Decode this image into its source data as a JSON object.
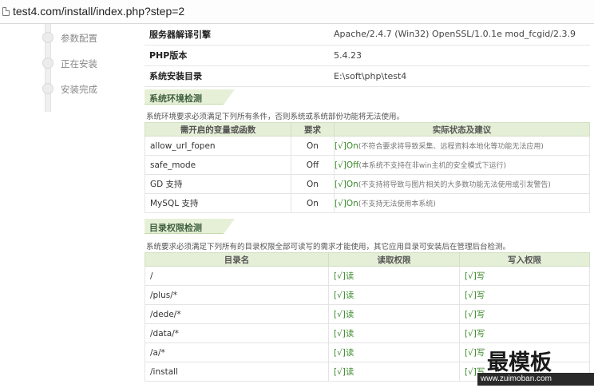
{
  "address_bar": {
    "url": "test4.com/install/index.php?step=2"
  },
  "sidebar": {
    "items": [
      {
        "label": "参数配置"
      },
      {
        "label": "正在安装"
      },
      {
        "label": "安装完成"
      }
    ]
  },
  "server_info": {
    "rows": [
      {
        "label": "服务器解译引擎",
        "value": "Apache/2.4.7 (Win32) OpenSSL/1.0.1e mod_fcgid/2.3.9"
      },
      {
        "label": "PHP版本",
        "value": "5.4.23"
      },
      {
        "label": "系统安装目录",
        "value": "E:\\soft\\php\\test4"
      }
    ]
  },
  "env_check": {
    "title": "系统环境检测",
    "description": "系统环境要求必须满足下列所有条件，否则系统或系统部份功能将无法使用。",
    "headers": {
      "name": "需开启的变量或函数",
      "required": "要求",
      "status": "实际状态及建议"
    },
    "rows": [
      {
        "name": "allow_url_fopen",
        "required": "On",
        "status": "[√]On",
        "note": "(不符合要求将导致采集、远程资料本地化等功能无法应用)"
      },
      {
        "name": "safe_mode",
        "required": "Off",
        "status": "[√]Off",
        "note": "(本系统不支持在非win主机的安全模式下运行)"
      },
      {
        "name": "GD 支持",
        "required": "On",
        "status": "[√]On",
        "note": "(不支持将导致与图片相关的大多数功能无法使用或引发警告)"
      },
      {
        "name": "MySQL 支持",
        "required": "On",
        "status": "[√]On",
        "note": "(不支持无法使用本系统)"
      }
    ]
  },
  "dir_check": {
    "title": "目录权限检测",
    "description": "系统要求必须满足下列所有的目录权限全部可读写的需求才能使用，其它应用目录可安装后在管理后台检测。",
    "headers": {
      "dir": "目录名",
      "read": "读取权限",
      "write": "写入权限"
    },
    "rows": [
      {
        "dir": "/",
        "read": "[√]读",
        "write": "[√]写"
      },
      {
        "dir": "/plus/*",
        "read": "[√]读",
        "write": "[√]写"
      },
      {
        "dir": "/dede/*",
        "read": "[√]读",
        "write": "[√]写"
      },
      {
        "dir": "/data/*",
        "read": "[√]读",
        "write": "[√]写"
      },
      {
        "dir": "/a/*",
        "read": "[√]读",
        "write": "[√]写"
      },
      {
        "dir": "/install",
        "read": "[√]读",
        "write": "[√]写"
      }
    ]
  },
  "watermark": {
    "text": "最模板",
    "url": "www.zuimoban.com"
  }
}
